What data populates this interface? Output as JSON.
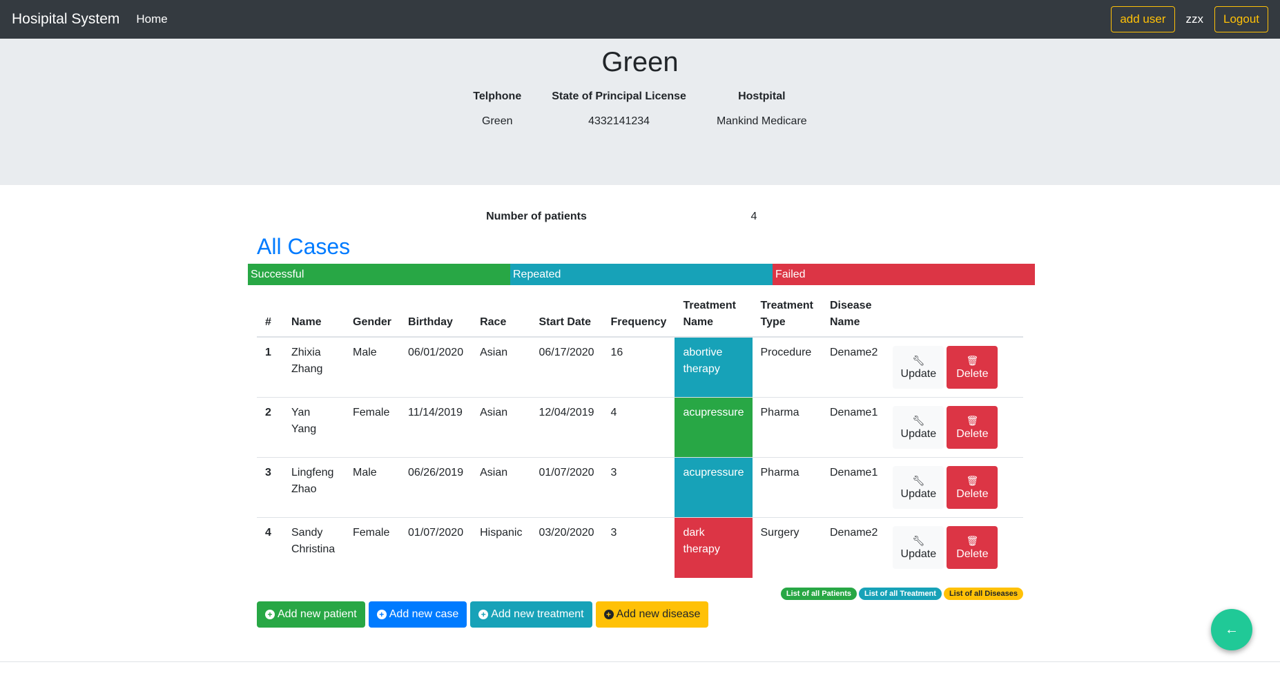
{
  "navbar": {
    "brand": "Hosipital System",
    "home": "Home",
    "add_user": "add user",
    "username": "zzx",
    "logout": "Logout"
  },
  "profile": {
    "name": "Green",
    "fields": [
      {
        "label": "Telphone",
        "value": "Green"
      },
      {
        "label": "State of Principal License",
        "value": "4332141234"
      },
      {
        "label": "Hostpital",
        "value": "Mankind Medicare"
      }
    ]
  },
  "summary": {
    "label": "Number of patients",
    "value": "4"
  },
  "cases": {
    "title": "All Cases",
    "legend": [
      "Successful",
      "Repeated",
      "Failed"
    ],
    "columns": [
      "#",
      "Name",
      "Gender",
      "Birthday",
      "Race",
      "Start Date",
      "Frequency",
      "Treatment Name",
      "Treatment Type",
      "Disease Name"
    ],
    "update_label": "Update",
    "delete_label": "Delete",
    "rows": [
      {
        "num": "1",
        "name": "Zhixia Zhang",
        "gender": "Male",
        "birthday": "06/01/2020",
        "race": "Asian",
        "start": "06/17/2020",
        "freq": "16",
        "tname": "abortive therapy",
        "status": "repeated",
        "ttype": "Procedure",
        "disease": "Dename2"
      },
      {
        "num": "2",
        "name": "Yan Yang",
        "gender": "Female",
        "birthday": "11/14/2019",
        "race": "Asian",
        "start": "12/04/2019",
        "freq": "4",
        "tname": "acupressure",
        "status": "successful",
        "ttype": "Pharma",
        "disease": "Dename1"
      },
      {
        "num": "3",
        "name": "Lingfeng Zhao",
        "gender": "Male",
        "birthday": "06/26/2019",
        "race": "Asian",
        "start": "01/07/2020",
        "freq": "3",
        "tname": "acupressure",
        "status": "repeated",
        "ttype": "Pharma",
        "disease": "Dename1"
      },
      {
        "num": "4",
        "name": "Sandy Christina",
        "gender": "Female",
        "birthday": "01/07/2020",
        "race": "Hispanic",
        "start": "03/20/2020",
        "freq": "3",
        "tname": "dark therapy",
        "status": "failed",
        "ttype": "Surgery",
        "disease": "Dename2"
      }
    ]
  },
  "badges": [
    "List of all Patients",
    "List of all Treatment",
    "List of all Diseases"
  ],
  "actions": {
    "add_patient": "Add new patient",
    "add_case": "Add new case",
    "add_treatment": "Add new treatment",
    "add_disease": "Add new disease"
  },
  "colors": {
    "successful": "#28a745",
    "repeated": "#17a2b8",
    "failed": "#dc3545",
    "primary": "#007bff",
    "warning": "#ffc107",
    "navbar": "#343a40"
  },
  "icons": {
    "update": "wrench-icon",
    "delete": "trash-icon",
    "add": "plus-circle-icon",
    "fab": "arrow-back-icon"
  }
}
